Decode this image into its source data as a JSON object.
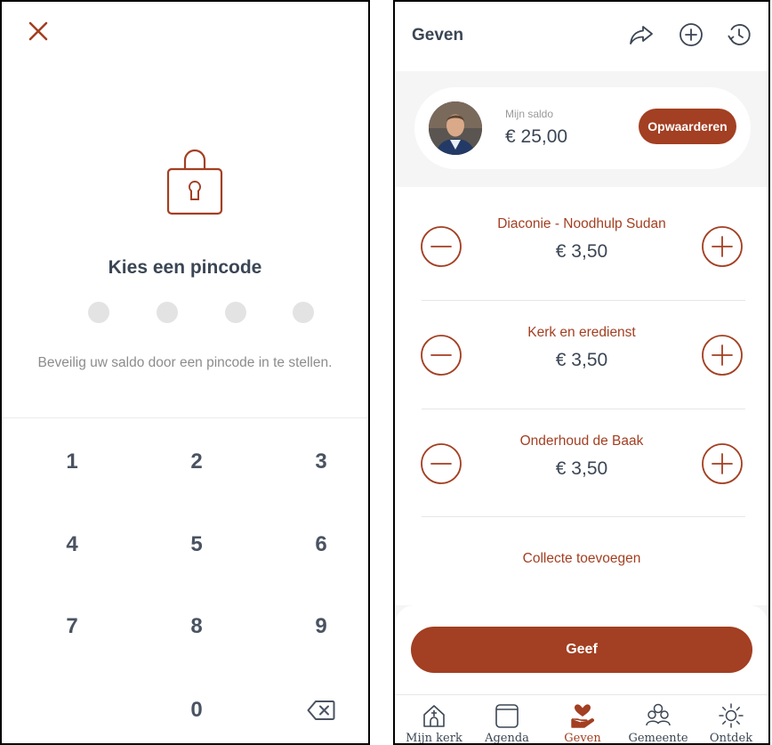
{
  "pin_screen": {
    "title": "Kies een pincode",
    "hint": "Beveilig uw saldo door een pincode in te stellen.",
    "pin_length": 4,
    "keys": [
      "1",
      "2",
      "3",
      "4",
      "5",
      "6",
      "7",
      "8",
      "9",
      "0"
    ],
    "icons": {
      "close": "close-icon",
      "lock": "lock-icon",
      "backspace": "backspace-icon"
    }
  },
  "give_screen": {
    "title": "Geven",
    "toolbar_icons": [
      "share-icon",
      "add-circle-icon",
      "history-icon"
    ],
    "balance": {
      "label": "Mijn saldo",
      "value": "€ 25,00",
      "topup_label": "Opwaarderen"
    },
    "funds": [
      {
        "name": "Diaconie - Noodhulp Sudan",
        "amount": "€ 3,50"
      },
      {
        "name": "Kerk en eredienst",
        "amount": "€ 3,50"
      },
      {
        "name": "Onderhoud de Baak",
        "amount": "€ 3,50"
      }
    ],
    "add_collection_label": "Collecte toevoegen",
    "give_label": "Geef",
    "nav": [
      {
        "label": "Mijn kerk",
        "icon": "church-home-icon",
        "active": false
      },
      {
        "label": "Agenda",
        "icon": "calendar-icon",
        "active": false
      },
      {
        "label": "Geven",
        "icon": "giving-hand-heart-icon",
        "active": true
      },
      {
        "label": "Gemeente",
        "icon": "community-icon",
        "active": false
      },
      {
        "label": "Ontdek",
        "icon": "sun-icon",
        "active": false
      }
    ]
  },
  "colors": {
    "accent": "#a33f22",
    "text": "#3b4654",
    "muted": "#8c8c8c",
    "dot": "#e3e3e3"
  }
}
